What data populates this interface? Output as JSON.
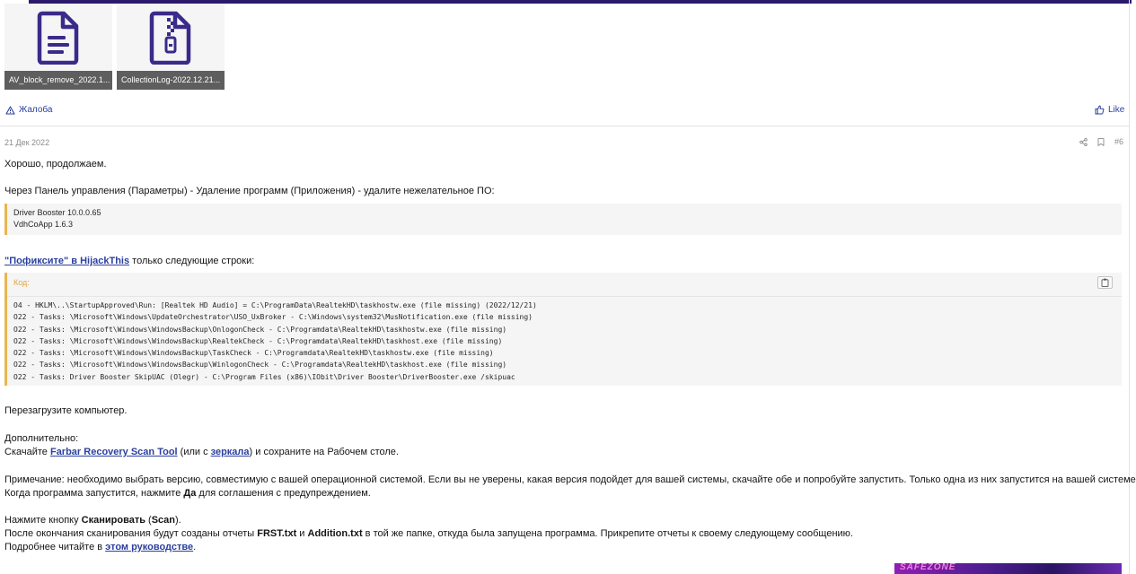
{
  "attachments": [
    {
      "name": "AV_block_remove_2022.1...",
      "icon": "document-file-icon"
    },
    {
      "name": "CollectionLog-2022.12.21...",
      "icon": "zip-archive-file-icon"
    }
  ],
  "post_actions": {
    "report_label": "Жалоба",
    "like_label": "Like"
  },
  "post": {
    "date": "21 Дек 2022",
    "number": "#6",
    "greeting": "Хорошо, продолжаем.",
    "uninstall_instruction": "Через Панель управления (Параметры) - Удаление программ (Приложения) - удалите нежелательное ПО:",
    "programs": [
      "Driver Booster 10.0.0.65",
      "VdhCoApp 1.6.3"
    ],
    "fix_link_text": "\"Пофиксите\" в HijackThis",
    "fix_rest": " только следующие строки:",
    "code_label": "Код:",
    "code_lines": [
      "O4 - HKLM\\..\\StartupApproved\\Run: [Realtek HD Audio] = C:\\ProgramData\\RealtekHD\\taskhostw.exe (file missing) (2022/12/21)",
      "O22 - Tasks: \\Microsoft\\Windows\\UpdateOrchestrator\\USO_UxBroker - C:\\Windows\\system32\\MusNotification.exe (file missing)",
      "O22 - Tasks: \\Microsoft\\Windows\\WindowsBackup\\OnlogonCheck - C:\\Programdata\\RealtekHD\\taskhostw.exe (file missing)",
      "O22 - Tasks: \\Microsoft\\Windows\\WindowsBackup\\RealtekCheck - C:\\Programdata\\RealtekHD\\taskhost.exe (file missing)",
      "O22 - Tasks: \\Microsoft\\Windows\\WindowsBackup\\TaskCheck - C:\\Programdata\\RealtekHD\\taskhostw.exe (file missing)",
      "O22 - Tasks: \\Microsoft\\Windows\\WindowsBackup\\WinlogonCheck - C:\\Programdata\\RealtekHD\\taskhost.exe (file missing)",
      "O22 - Tasks: Driver Booster SkipUAC (Olegr) - C:\\Program Files (x86)\\IObit\\Driver Booster\\DriverBooster.exe /skipuac"
    ],
    "reboot": "Перезагрузите компьютер.",
    "extra_heading": "Дополнительно:",
    "download_pre": "Скачайте ",
    "frst_link": "Farbar Recovery Scan Tool",
    "download_mid": " (или с ",
    "mirror_link": "зеркала",
    "download_post": ") и сохраните на Рабочем столе.",
    "note_line1": "Примечание: необходимо выбрать версию, совместимую с вашей операционной системой. Если вы не уверены, какая версия подойдет для вашей системы, скачайте обе и попробуйте запустить. Только одна из них запустится на вашей системе.",
    "note_line2_pre": "Когда программа запустится, нажмите ",
    "note_line2_bold": "Да",
    "note_line2_post": " для соглашения с предупреждением.",
    "scan_pre": "Нажмите кнопку ",
    "scan_bold": "Сканировать",
    "scan_mid": " (",
    "scan_bold2": "Scan",
    "scan_post": ").",
    "after_pre": "После окончания сканирования будут созданы отчеты ",
    "after_frst": "FRST.txt",
    "after_and": " и ",
    "after_add": "Addition.txt",
    "after_post": " в той же папке, откуда была запущена программа. Прикрепите отчеты к своему следующему сообщению.",
    "more_pre": "Подробнее читайте в ",
    "guide_link": "этом руководстве",
    "more_post": "."
  },
  "banner_text": "SAFEZONE",
  "colors": {
    "link": "#2b3f9e",
    "accent": "#e9b64f",
    "icon": "#3b2a8a",
    "topbar": "#2b1a6b"
  }
}
